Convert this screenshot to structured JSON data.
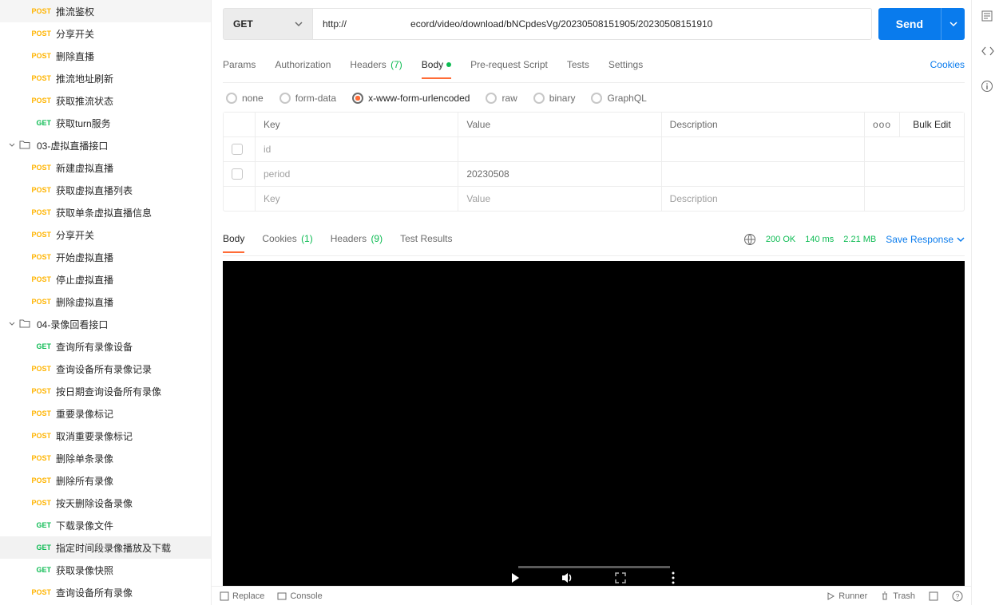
{
  "sidebar": {
    "groups": [
      {
        "type": "items",
        "items": [
          {
            "method": "POST",
            "name": "推流鉴权"
          },
          {
            "method": "POST",
            "name": "分享开关"
          },
          {
            "method": "POST",
            "name": "删除直播"
          },
          {
            "method": "POST",
            "name": "推流地址刷新"
          },
          {
            "method": "POST",
            "name": "获取推流状态"
          },
          {
            "method": "GET",
            "name": "获取turn服务"
          }
        ]
      },
      {
        "type": "folder",
        "name": "03-虚拟直播接口",
        "items": [
          {
            "method": "POST",
            "name": "新建虚拟直播"
          },
          {
            "method": "POST",
            "name": "获取虚拟直播列表"
          },
          {
            "method": "POST",
            "name": "获取单条虚拟直播信息"
          },
          {
            "method": "POST",
            "name": "分享开关"
          },
          {
            "method": "POST",
            "name": "开始虚拟直播"
          },
          {
            "method": "POST",
            "name": "停止虚拟直播"
          },
          {
            "method": "POST",
            "name": "删除虚拟直播"
          }
        ]
      },
      {
        "type": "folder",
        "name": "04-录像回看接口",
        "items": [
          {
            "method": "GET",
            "name": "查询所有录像设备"
          },
          {
            "method": "POST",
            "name": "查询设备所有录像记录"
          },
          {
            "method": "POST",
            "name": "按日期查询设备所有录像"
          },
          {
            "method": "POST",
            "name": "重要录像标记"
          },
          {
            "method": "POST",
            "name": "取消重要录像标记"
          },
          {
            "method": "POST",
            "name": "删除单条录像"
          },
          {
            "method": "POST",
            "name": "删除所有录像"
          },
          {
            "method": "POST",
            "name": "按天删除设备录像"
          },
          {
            "method": "GET",
            "name": "下载录像文件"
          },
          {
            "method": "GET",
            "name": "指定时间段录像播放及下载",
            "active": true
          },
          {
            "method": "GET",
            "name": "获取录像快照"
          },
          {
            "method": "POST",
            "name": "查询设备所有录像"
          }
        ]
      }
    ]
  },
  "request": {
    "method": "GET",
    "url_prefix": "http://",
    "url_suffix": "ecord/video/download/bNCpdesVg/20230508151905/20230508151910",
    "send_label": "Send",
    "tabs": {
      "params": "Params",
      "authorization": "Authorization",
      "headers": "Headers",
      "headers_count": "(7)",
      "body": "Body",
      "prerequest": "Pre-request Script",
      "tests": "Tests",
      "settings": "Settings",
      "cookies": "Cookies"
    },
    "body_types": {
      "none": "none",
      "formdata": "form-data",
      "xwww": "x-www-form-urlencoded",
      "raw": "raw",
      "binary": "binary",
      "graphql": "GraphQL"
    },
    "kv": {
      "head_key": "Key",
      "head_value": "Value",
      "head_desc": "Description",
      "bulk": "Bulk Edit",
      "more": "ooo",
      "rows": [
        {
          "key": "id",
          "value": "",
          "desc": ""
        },
        {
          "key": "period",
          "value": "20230508",
          "desc": ""
        }
      ],
      "placeholder_key": "Key",
      "placeholder_value": "Value",
      "placeholder_desc": "Description"
    }
  },
  "response": {
    "tabs": {
      "body": "Body",
      "cookies": "Cookies",
      "cookies_count": "(1)",
      "headers": "Headers",
      "headers_count": "(9)",
      "tests": "Test Results"
    },
    "status_code": "200",
    "status_text": "OK",
    "time": "140 ms",
    "size": "2.21 MB",
    "save": "Save Response"
  },
  "footer": {
    "replace": "Replace",
    "console": "Console",
    "runner": "Runner",
    "trash": "Trash"
  }
}
